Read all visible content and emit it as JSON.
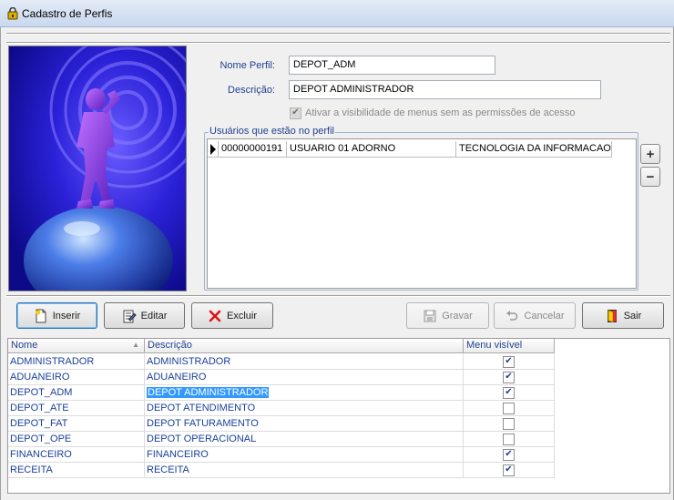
{
  "window": {
    "title": "Cadastro de Perfis"
  },
  "form": {
    "nome_label": "Nome Perfil:",
    "nome_value": "DEPOT_ADM",
    "descricao_label": "Descrição:",
    "descricao_value": "DEPOT ADMINISTRADOR",
    "checkbox_label": "Ativar a visibilidade de menus sem as permissões de acesso",
    "checkbox_checked": true
  },
  "users": {
    "group_title": "Usuários que estão no perfil",
    "rows": [
      {
        "code": "00000000191",
        "name": "USUARIO 01 ADORNO",
        "dept": "TECNOLOGIA DA INFORMACAO"
      }
    ]
  },
  "buttons": {
    "inserir": "Inserir",
    "editar": "Editar",
    "excluir": "Excluir",
    "gravar": "Gravar",
    "cancelar": "Cancelar",
    "sair": "Sair"
  },
  "grid": {
    "headers": {
      "nome": "Nome",
      "descricao": "Descrição",
      "menu": "Menu visível"
    },
    "rows": [
      {
        "nome": "ADMINISTRADOR",
        "descricao": "ADMINISTRADOR",
        "menu": true
      },
      {
        "nome": "ADUANEIRO",
        "descricao": "ADUANEIRO",
        "menu": true
      },
      {
        "nome": "DEPOT_ADM",
        "descricao": "DEPOT ADMINISTRADOR",
        "menu": true,
        "selected": true
      },
      {
        "nome": "DEPOT_ATE",
        "descricao": "DEPOT ATENDIMENTO",
        "menu": false
      },
      {
        "nome": "DEPOT_FAT",
        "descricao": "DEPOT FATURAMENTO",
        "menu": false
      },
      {
        "nome": "DEPOT_OPE",
        "descricao": "DEPOT OPERACIONAL",
        "menu": false
      },
      {
        "nome": "FINANCEIRO",
        "descricao": "FINANCEIRO",
        "menu": true
      },
      {
        "nome": "RECEITA",
        "descricao": "RECEITA",
        "menu": true
      }
    ]
  },
  "colors": {
    "label": "#1f3f8f",
    "grid_text": "#1a3f9a",
    "selection": "#3399ff"
  }
}
